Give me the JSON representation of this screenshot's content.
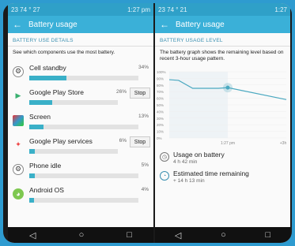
{
  "left": {
    "status": {
      "left": "23  74 ° 27",
      "time": "1:27 pm"
    },
    "title": "Battery usage",
    "section": "BATTERY USE DETAILS",
    "desc": "See which components use the most battery.",
    "stop_label": "Stop",
    "items": [
      {
        "name": "Cell standby",
        "pct": "34%",
        "value": 34,
        "stop": false
      },
      {
        "name": "Google Play Store",
        "pct": "26%",
        "value": 26,
        "stop": true
      },
      {
        "name": "Screen",
        "pct": "13%",
        "value": 13,
        "stop": false
      },
      {
        "name": "Google Play services",
        "pct": "6%",
        "value": 6,
        "stop": true
      },
      {
        "name": "Phone idle",
        "pct": "5%",
        "value": 5,
        "stop": false
      },
      {
        "name": "Android OS",
        "pct": "4%",
        "value": 4,
        "stop": false
      }
    ]
  },
  "right": {
    "status": {
      "left": "23  74 ° 21",
      "time": "1:27"
    },
    "title": "Battery usage",
    "section": "BATTERY USAGE LEVEL",
    "desc": "The battery graph shows the remaining level based on recent 3-hour usage pattern.",
    "usage_title": "Usage on battery",
    "usage_value": "4 h 42 min",
    "est_title": "Estimated time remaining",
    "est_value": "+ 14 h 13 min"
  },
  "chart_data": {
    "type": "line",
    "y_ticks": [
      "100%",
      "90%",
      "80%",
      "70%",
      "60%",
      "50%",
      "40%",
      "30%",
      "20%",
      "10%",
      "0%"
    ],
    "x_labels": [
      "1:27 pm",
      "+3h"
    ],
    "ylim": [
      0,
      100
    ],
    "series": [
      {
        "values": [
          [
            0,
            88
          ],
          [
            0.08,
            87
          ],
          [
            0.2,
            75
          ],
          [
            0.42,
            75
          ],
          [
            0.5,
            76
          ],
          [
            1.0,
            58
          ]
        ]
      }
    ]
  },
  "colors": {
    "accent": "#3ab0d8",
    "bar": "#3ab0c8",
    "chart_line": "#4aa8c0"
  },
  "icons": [
    "back-arrow-icon",
    "gear-icon",
    "play-store-icon",
    "screen-icon",
    "play-services-icon",
    "android-icon"
  ]
}
